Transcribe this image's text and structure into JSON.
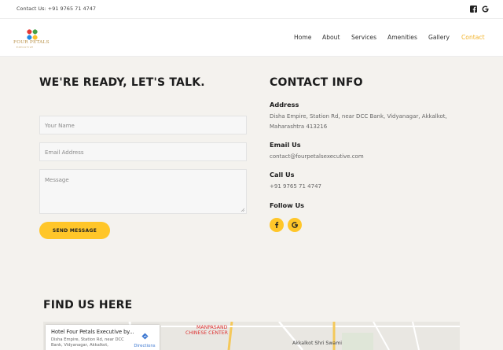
{
  "topbar": {
    "contact_text": "Contact Us: +91 9765 71 4747",
    "social_icons": [
      "facebook-square-icon",
      "google-icon"
    ]
  },
  "brand": {
    "name": "FOUR PETALS",
    "tagline": "EXECUTIVE",
    "petal_colors": [
      "#e53935",
      "#43a047",
      "#1e88e5",
      "#fbc02d"
    ]
  },
  "nav": {
    "items": [
      {
        "label": "Home"
      },
      {
        "label": "About"
      },
      {
        "label": "Services"
      },
      {
        "label": "Amenities"
      },
      {
        "label": "Gallery"
      },
      {
        "label": "Contact"
      }
    ],
    "active": "Contact"
  },
  "form": {
    "heading": "WE'RE READY, LET'S TALK.",
    "name_placeholder": "Your Name",
    "email_placeholder": "Email Address",
    "message_placeholder": "Message",
    "submit_label": "SEND MESSAGE"
  },
  "contact_info": {
    "heading": "CONTACT INFO",
    "address_label": "Address",
    "address_line1": "Disha Empire, Station Rd, near DCC Bank, Vidyanagar, Akkalkot,",
    "address_line2": "Maharashtra 413216",
    "email_label": "Email Us",
    "email": "contact@fourpetalsexecutive.com",
    "call_label": "Call Us",
    "phone": "+91 9765 71 4747",
    "follow_label": "Follow Us",
    "follow_icons": [
      "facebook-icon",
      "google-icon"
    ]
  },
  "map": {
    "heading": "FIND US HERE",
    "place_name": "Hotel Four Petals Executive by...",
    "place_address": "Disha Empire, Station Rd, near DCC Bank, Vidyanagar, Akkalkot,",
    "directions_label": "Directions",
    "label_manpasand": "MANPASAND",
    "label_chinese": "CHINESE CENTER",
    "label_swami": "Akkalkot Shri Swami"
  },
  "colors": {
    "accent": "#ffc629",
    "active_nav": "#f2b32a",
    "background": "#f4f2ee"
  }
}
